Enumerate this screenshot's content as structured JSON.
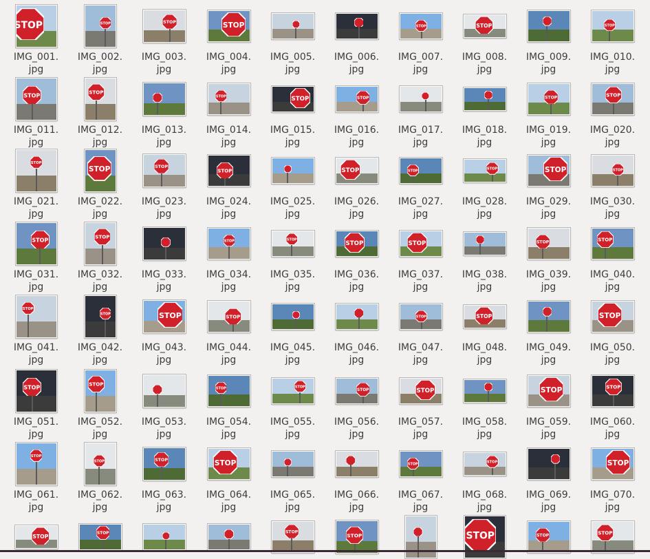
{
  "file_manager": {
    "files": [
      {
        "name": "IMG_001.",
        "ext": "jpg"
      },
      {
        "name": "IMG_002.",
        "ext": "jpg"
      },
      {
        "name": "IMG_003.",
        "ext": "jpg"
      },
      {
        "name": "IMG_004.",
        "ext": "jpg"
      },
      {
        "name": "IMG_005.",
        "ext": "jpg"
      },
      {
        "name": "IMG_006.",
        "ext": "jpg"
      },
      {
        "name": "IMG_007.",
        "ext": "jpg"
      },
      {
        "name": "IMG_008.",
        "ext": "jpg"
      },
      {
        "name": "IMG_009.",
        "ext": "jpg"
      },
      {
        "name": "IMG_010.",
        "ext": "jpg"
      },
      {
        "name": "IMG_011.",
        "ext": "jpg"
      },
      {
        "name": "IMG_012.",
        "ext": "jpg"
      },
      {
        "name": "IMG_013.",
        "ext": "jpg"
      },
      {
        "name": "IMG_014.",
        "ext": "jpg"
      },
      {
        "name": "IMG_015.",
        "ext": "jpg"
      },
      {
        "name": "IMG_016.",
        "ext": "jpg"
      },
      {
        "name": "IMG_017.",
        "ext": "jpg"
      },
      {
        "name": "IMG_018.",
        "ext": "jpg"
      },
      {
        "name": "IMG_019.",
        "ext": "jpg"
      },
      {
        "name": "IMG_020.",
        "ext": "jpg"
      },
      {
        "name": "IMG_021.",
        "ext": "jpg"
      },
      {
        "name": "IMG_022.",
        "ext": "jpg"
      },
      {
        "name": "IMG_023.",
        "ext": "jpg"
      },
      {
        "name": "IMG_024.",
        "ext": "jpg"
      },
      {
        "name": "IMG_025.",
        "ext": "jpg"
      },
      {
        "name": "IMG_026.",
        "ext": "jpg"
      },
      {
        "name": "IMG_027.",
        "ext": "jpg"
      },
      {
        "name": "IMG_028.",
        "ext": "jpg"
      },
      {
        "name": "IMG_029.",
        "ext": "jpg"
      },
      {
        "name": "IMG_030.",
        "ext": "jpg"
      },
      {
        "name": "IMG_031.",
        "ext": "jpg"
      },
      {
        "name": "IMG_032.",
        "ext": "jpg"
      },
      {
        "name": "IMG_033.",
        "ext": "jpg"
      },
      {
        "name": "IMG_034.",
        "ext": "jpg"
      },
      {
        "name": "IMG_035.",
        "ext": "jpg"
      },
      {
        "name": "IMG_036.",
        "ext": "jpg"
      },
      {
        "name": "IMG_037.",
        "ext": "jpg"
      },
      {
        "name": "IMG_038.",
        "ext": "jpg"
      },
      {
        "name": "IMG_039.",
        "ext": "jpg"
      },
      {
        "name": "IMG_040.",
        "ext": "jpg"
      },
      {
        "name": "IMG_041.",
        "ext": "jpg"
      },
      {
        "name": "IMG_042.",
        "ext": "jpg"
      },
      {
        "name": "IMG_043.",
        "ext": "jpg"
      },
      {
        "name": "IMG_044.",
        "ext": "jpg"
      },
      {
        "name": "IMG_045.",
        "ext": "jpg"
      },
      {
        "name": "IMG_046.",
        "ext": "jpg"
      },
      {
        "name": "IMG_047.",
        "ext": "jpg"
      },
      {
        "name": "IMG_048.",
        "ext": "jpg"
      },
      {
        "name": "IMG_049.",
        "ext": "jpg"
      },
      {
        "name": "IMG_050.",
        "ext": "jpg"
      },
      {
        "name": "IMG_051.",
        "ext": "jpg"
      },
      {
        "name": "IMG_052.",
        "ext": "jpg"
      },
      {
        "name": "IMG_053.",
        "ext": "jpg"
      },
      {
        "name": "IMG_054.",
        "ext": "jpg"
      },
      {
        "name": "IMG_055.",
        "ext": "jpg"
      },
      {
        "name": "IMG_056.",
        "ext": "jpg"
      },
      {
        "name": "IMG_057.",
        "ext": "jpg"
      },
      {
        "name": "IMG_058.",
        "ext": "jpg"
      },
      {
        "name": "IMG_059.",
        "ext": "jpg"
      },
      {
        "name": "IMG_060.",
        "ext": "jpg"
      },
      {
        "name": "IMG_061.",
        "ext": "jpg"
      },
      {
        "name": "IMG_062.",
        "ext": "jpg"
      },
      {
        "name": "IMG_063.",
        "ext": "jpg"
      },
      {
        "name": "IMG_064.",
        "ext": "jpg"
      },
      {
        "name": "IMG_065.",
        "ext": "jpg"
      },
      {
        "name": "IMG_066.",
        "ext": "jpg"
      },
      {
        "name": "IMG_067.",
        "ext": "jpg"
      },
      {
        "name": "IMG_068.",
        "ext": "jpg"
      },
      {
        "name": "IMG_069.",
        "ext": "jpg"
      },
      {
        "name": "IMG_070.",
        "ext": "jpg"
      }
    ],
    "partial_row_count": 10,
    "sign_text": "STOP",
    "colors": {
      "background": "#f2f1f0",
      "label_text": "#3c3c3c",
      "stop_sign_red": "#d0212b",
      "thumbnail_border": "#ffffff"
    }
  }
}
